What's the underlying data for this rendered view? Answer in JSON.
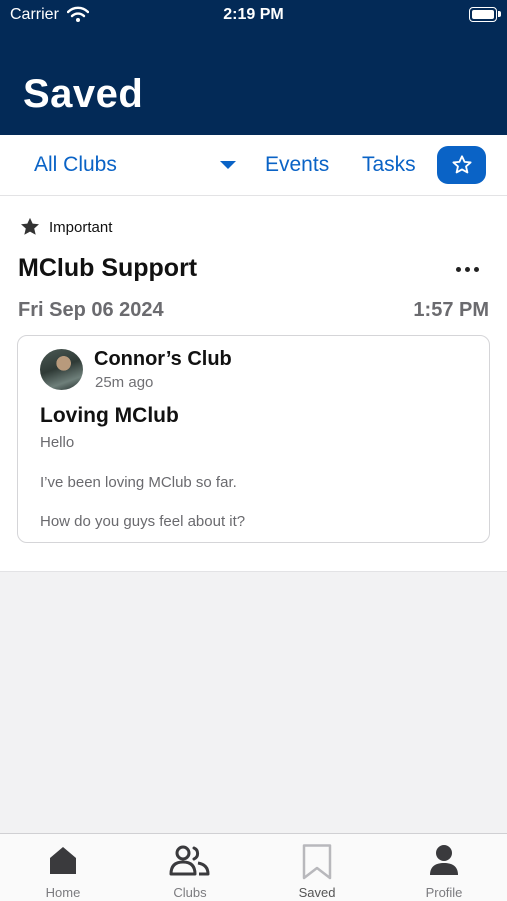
{
  "status_bar": {
    "carrier": "Carrier",
    "time": "2:19 PM"
  },
  "header": {
    "title": "Saved"
  },
  "filters": {
    "club_dropdown": "All Clubs",
    "events_label": "Events",
    "tasks_label": "Tasks",
    "starred_icon": "star-outline-icon"
  },
  "saved_item": {
    "flag": "Important",
    "title": "MClub Support",
    "date": "Fri Sep 06 2024",
    "time": "1:57 PM",
    "post": {
      "club": "Connor’s Club",
      "age": "25m ago",
      "title": "Loving MClub",
      "lines": [
        "Hello",
        "I’ve been loving MClub so far.",
        "How do you guys feel about it?"
      ]
    }
  },
  "tabs": [
    {
      "label": "Home",
      "icon": "home-icon"
    },
    {
      "label": "Clubs",
      "icon": "people-icon"
    },
    {
      "label": "Saved",
      "icon": "bookmark-icon"
    },
    {
      "label": "Profile",
      "icon": "person-icon"
    }
  ],
  "colors": {
    "header_bg": "#032a57",
    "accent": "#0a63c6",
    "tab_active": "#7b7b7f"
  }
}
